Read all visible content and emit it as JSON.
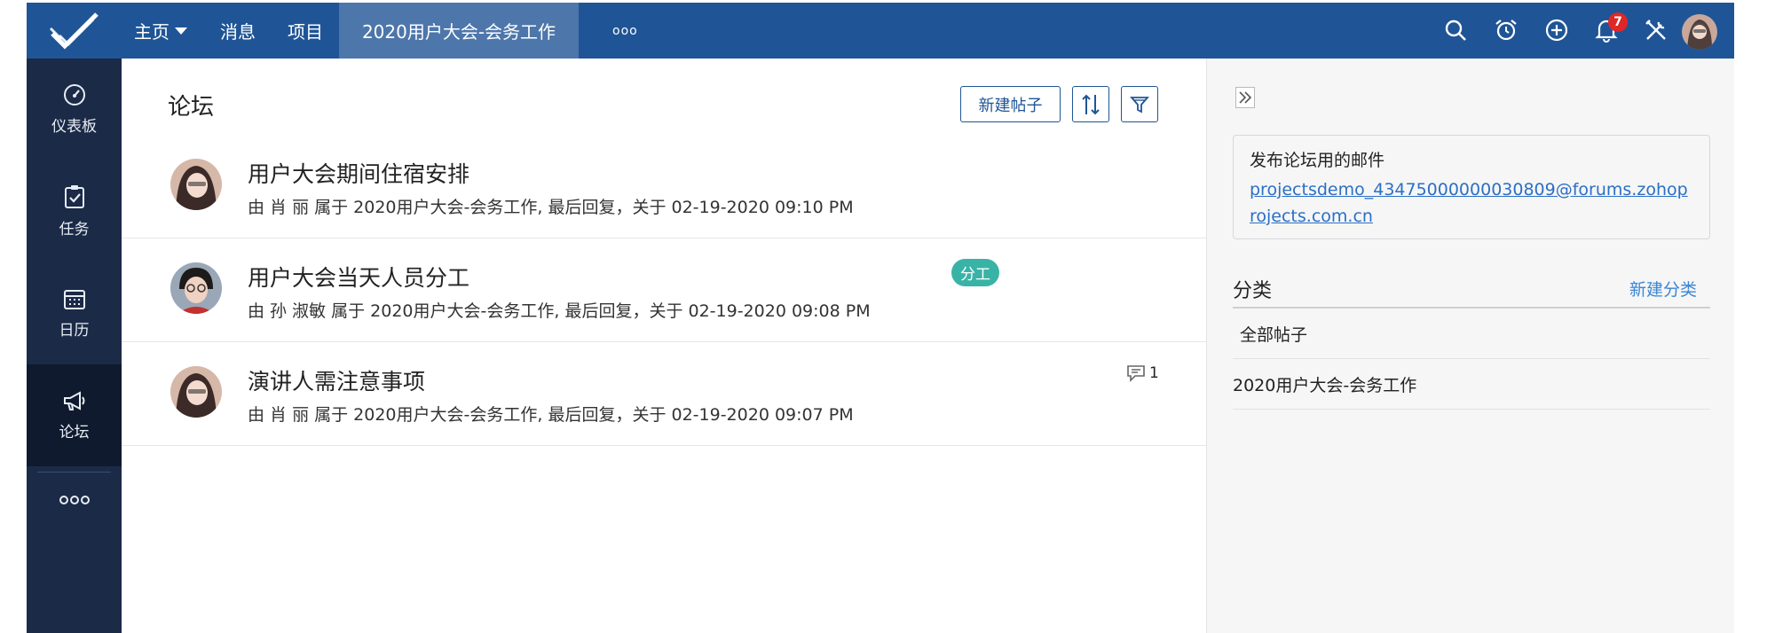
{
  "colors": {
    "topbar": "#1f5596",
    "active_tab": "#4d76ab",
    "sidebar": "#1b2a47",
    "tag": "#3ab3a7",
    "link": "#2b6fc6",
    "badge": "#e02727"
  },
  "topbar": {
    "logo_icon": "check-mark-logo-icon",
    "nav": [
      {
        "label": "主页",
        "has_caret": true
      },
      {
        "label": "消息"
      },
      {
        "label": "项目"
      },
      {
        "label": "2020用户大会-会务工作",
        "active": true
      },
      {
        "label": "ooo"
      }
    ],
    "icons": [
      "search-icon",
      "alarm-clock-icon",
      "add-circle-icon",
      "bell-icon",
      "tools-icon"
    ],
    "notification_count": "7"
  },
  "sidebar": {
    "items": [
      {
        "label": "仪表板",
        "icon": "dashboard-gauge-icon"
      },
      {
        "label": "任务",
        "icon": "clipboard-check-icon"
      },
      {
        "label": "日历",
        "icon": "calendar-icon"
      },
      {
        "label": "论坛",
        "icon": "megaphone-icon",
        "active": true
      }
    ],
    "more": "ooo"
  },
  "main": {
    "title": "论坛",
    "new_post_label": "新建帖子",
    "posts": [
      {
        "title": "用户大会期间住宿安排",
        "meta": "由 肖 丽 属于 2020用户大会-会务工作, 最后回复，关于 02-19-2020 09:10 PM"
      },
      {
        "title": "用户大会当天人员分工",
        "meta": "由 孙 淑敏 属于 2020用户大会-会务工作, 最后回复，关于 02-19-2020 09:08 PM",
        "tag": "分工"
      },
      {
        "title": "演讲人需注意事项",
        "meta": "由 肖 丽 属于 2020用户大会-会务工作, 最后回复，关于 02-19-2020 09:07 PM",
        "comments": "1"
      }
    ]
  },
  "right_panel": {
    "mail_label": "发布论坛用的邮件",
    "mail_address": "projectsdemo_43475000000030809@forums.zohoprojects.com.cn",
    "categories_title": "分类",
    "new_category": "新建分类",
    "categories": [
      "全部帖子",
      "2020用户大会-会务工作"
    ]
  }
}
